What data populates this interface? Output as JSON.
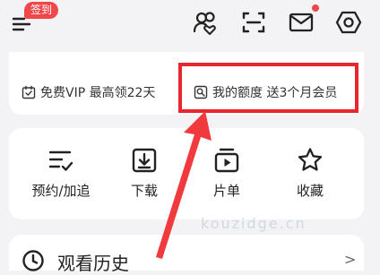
{
  "header": {
    "signin_badge": "签到",
    "icons": [
      "menu-icon",
      "friends-icon",
      "scan-icon",
      "mail-icon",
      "settings-icon"
    ],
    "mail_has_notification": true
  },
  "vip_card": {
    "free_vip": "免费VIP 最高领22天",
    "my_quota": "我的额度 送3个月会员"
  },
  "functions": [
    {
      "label": "预约/加追",
      "icon": "reserve-list-icon"
    },
    {
      "label": "下载",
      "icon": "download-icon"
    },
    {
      "label": "片单",
      "icon": "playlist-icon"
    },
    {
      "label": "收藏",
      "icon": "star-icon"
    }
  ],
  "history": {
    "title": "观看历史",
    "chevron": ">"
  },
  "watermark": "kouzidge.cn",
  "colors": {
    "accent_red": "#f0474a",
    "highlight_red": "#e8262e",
    "background": "#f3f3f5"
  }
}
